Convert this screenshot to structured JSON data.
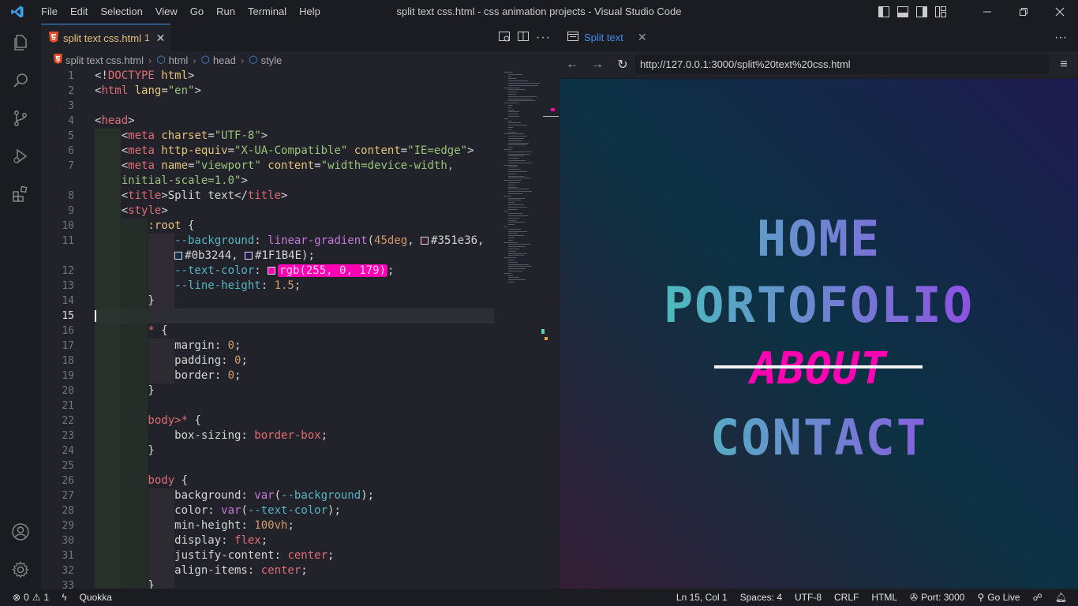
{
  "window": {
    "title": "split text css.html - css animation projects - Visual Studio Code",
    "menu": [
      "File",
      "Edit",
      "Selection",
      "View",
      "Go",
      "Run",
      "Terminal",
      "Help"
    ]
  },
  "editor": {
    "tab": {
      "label": "split text css.html",
      "modified_marker": "1"
    },
    "breadcrumb": [
      "split text css.html",
      "html",
      "head",
      "style"
    ],
    "current_line": 15,
    "lines": [
      {
        "n": "1",
        "segments": [
          [
            "p",
            "<!"
          ],
          [
            "k",
            "DOCTYPE"
          ],
          [
            "y",
            " html"
          ],
          [
            "p",
            ">"
          ]
        ]
      },
      {
        "n": "2",
        "segments": [
          [
            "p",
            "<"
          ],
          [
            "k",
            "html"
          ],
          [
            "a",
            " lang"
          ],
          [
            "p",
            "="
          ],
          [
            "s",
            "\"en\""
          ],
          [
            "p",
            ">"
          ]
        ]
      },
      {
        "n": "3",
        "segments": []
      },
      {
        "n": "4",
        "segments": [
          [
            "p",
            "<"
          ],
          [
            "k",
            "head"
          ],
          [
            "p",
            ">"
          ]
        ]
      },
      {
        "n": "5",
        "segments": [
          [
            "p",
            "    <"
          ],
          [
            "k",
            "meta"
          ],
          [
            "a",
            " charset"
          ],
          [
            "p",
            "="
          ],
          [
            "s",
            "\"UTF-8\""
          ],
          [
            "p",
            ">"
          ]
        ]
      },
      {
        "n": "6",
        "segments": [
          [
            "p",
            "    <"
          ],
          [
            "k",
            "meta"
          ],
          [
            "a",
            " http-equiv"
          ],
          [
            "p",
            "="
          ],
          [
            "s",
            "\"X-UA-Compatible\""
          ],
          [
            "a",
            " content"
          ],
          [
            "p",
            "="
          ],
          [
            "s",
            "\"IE=edge\""
          ],
          [
            "p",
            ">"
          ]
        ]
      },
      {
        "n": "7",
        "segments": [
          [
            "p",
            "    <"
          ],
          [
            "k",
            "meta"
          ],
          [
            "a",
            " name"
          ],
          [
            "p",
            "="
          ],
          [
            "s",
            "\"viewport\""
          ],
          [
            "a",
            " content"
          ],
          [
            "p",
            "="
          ],
          [
            "s",
            "\"width=device-width,"
          ]
        ]
      },
      {
        "n": "",
        "segments": [
          [
            "s",
            "    initial-scale=1.0\""
          ],
          [
            "p",
            ">"
          ]
        ]
      },
      {
        "n": "8",
        "segments": [
          [
            "p",
            "    <"
          ],
          [
            "k",
            "title"
          ],
          [
            "p",
            ">Split text</"
          ],
          [
            "k",
            "title"
          ],
          [
            "p",
            ">"
          ]
        ]
      },
      {
        "n": "9",
        "segments": [
          [
            "p",
            "    <"
          ],
          [
            "k",
            "style"
          ],
          [
            "p",
            ">"
          ]
        ]
      },
      {
        "n": "10",
        "segments": [
          [
            "sel",
            "        :root"
          ],
          [
            "p",
            " {"
          ]
        ]
      },
      {
        "n": "11",
        "segments": [
          [
            "var",
            "            --background"
          ],
          [
            "p",
            ": "
          ],
          [
            "fn",
            "linear-gradient"
          ],
          [
            "p",
            "("
          ],
          [
            "num",
            "45deg"
          ],
          [
            "p",
            ", "
          ],
          [
            "swatch",
            "#351e36"
          ],
          [
            "p",
            "#351e36,"
          ]
        ]
      },
      {
        "n": "",
        "segments": [
          [
            "p",
            "            "
          ],
          [
            "swatch",
            "#0b3244"
          ],
          [
            "p",
            "#0b3244, "
          ],
          [
            "swatch",
            "#1F1B4E"
          ],
          [
            "p",
            "#1F1B4E);"
          ]
        ]
      },
      {
        "n": "12",
        "segments": [
          [
            "var",
            "            --text-color"
          ],
          [
            "p",
            ": "
          ],
          [
            "swatchpink",
            "#ff00b3"
          ],
          [
            "rgb",
            "rgb(255, 0, 179)"
          ],
          [
            "p",
            ";"
          ]
        ]
      },
      {
        "n": "13",
        "segments": [
          [
            "var",
            "            --line-height"
          ],
          [
            "p",
            ": "
          ],
          [
            "num",
            "1.5"
          ],
          [
            "p",
            ";"
          ]
        ]
      },
      {
        "n": "14",
        "segments": [
          [
            "p",
            "        }"
          ]
        ]
      },
      {
        "n": "15",
        "segments": []
      },
      {
        "n": "16",
        "segments": [
          [
            "kw",
            "        *"
          ],
          [
            "p",
            " {"
          ]
        ]
      },
      {
        "n": "17",
        "segments": [
          [
            "p",
            "            margin: "
          ],
          [
            "num",
            "0"
          ],
          [
            "p",
            ";"
          ]
        ]
      },
      {
        "n": "18",
        "segments": [
          [
            "p",
            "            padding: "
          ],
          [
            "num",
            "0"
          ],
          [
            "p",
            ";"
          ]
        ]
      },
      {
        "n": "19",
        "segments": [
          [
            "p",
            "            border: "
          ],
          [
            "num",
            "0"
          ],
          [
            "p",
            ";"
          ]
        ]
      },
      {
        "n": "20",
        "segments": [
          [
            "p",
            "        }"
          ]
        ]
      },
      {
        "n": "21",
        "segments": []
      },
      {
        "n": "22",
        "segments": [
          [
            "kw",
            "        body>*"
          ],
          [
            "p",
            " {"
          ]
        ]
      },
      {
        "n": "23",
        "segments": [
          [
            "p",
            "            box-sizing: "
          ],
          [
            "kw",
            "border-box"
          ],
          [
            "p",
            ";"
          ]
        ]
      },
      {
        "n": "24",
        "segments": [
          [
            "p",
            "        }"
          ]
        ]
      },
      {
        "n": "25",
        "segments": []
      },
      {
        "n": "26",
        "segments": [
          [
            "kw",
            "        body"
          ],
          [
            "p",
            " {"
          ]
        ]
      },
      {
        "n": "27",
        "segments": [
          [
            "p",
            "            background: "
          ],
          [
            "fn",
            "var"
          ],
          [
            "p",
            "("
          ],
          [
            "var",
            "--background"
          ],
          [
            "p",
            ");"
          ]
        ]
      },
      {
        "n": "28",
        "segments": [
          [
            "p",
            "            color: "
          ],
          [
            "fn",
            "var"
          ],
          [
            "p",
            "("
          ],
          [
            "var",
            "--text-color"
          ],
          [
            "p",
            ");"
          ]
        ]
      },
      {
        "n": "29",
        "segments": [
          [
            "p",
            "            min-height: "
          ],
          [
            "num",
            "100vh"
          ],
          [
            "p",
            ";"
          ]
        ]
      },
      {
        "n": "30",
        "segments": [
          [
            "p",
            "            display: "
          ],
          [
            "kw",
            "flex"
          ],
          [
            "p",
            ";"
          ]
        ]
      },
      {
        "n": "31",
        "segments": [
          [
            "p",
            "            justify-content: "
          ],
          [
            "kw",
            "center"
          ],
          [
            "p",
            ";"
          ]
        ]
      },
      {
        "n": "32",
        "segments": [
          [
            "p",
            "            align-items: "
          ],
          [
            "kw",
            "center"
          ],
          [
            "p",
            ";"
          ]
        ]
      },
      {
        "n": "33",
        "segments": [
          [
            "p",
            "        }"
          ]
        ]
      }
    ]
  },
  "preview": {
    "tab_label": "Split text",
    "url": "http://127.0.0.1:3000/split%20text%20css.html",
    "links": [
      {
        "label": "HOME",
        "size": 62
      },
      {
        "label": "PORTOFOLIO",
        "size": 62
      },
      {
        "label": "ABOUT",
        "size": 54,
        "style": "struck"
      },
      {
        "label": "CONTACT",
        "size": 62
      }
    ],
    "page_colors": {
      "gradient": [
        "#351e36",
        "#0b3244",
        "#1F1B4E"
      ],
      "text_gradient": [
        "#35e0b0",
        "#a52cf0"
      ],
      "about_color": "#ff00b3"
    }
  },
  "statusbar": {
    "errors": "0",
    "warnings": "1",
    "quokka": "Quokka",
    "position": "Ln 15, Col 1",
    "spaces": "Spaces: 4",
    "encoding": "UTF-8",
    "eol": "CRLF",
    "language": "HTML",
    "port": "Port: 3000",
    "golive": "Go Live"
  }
}
